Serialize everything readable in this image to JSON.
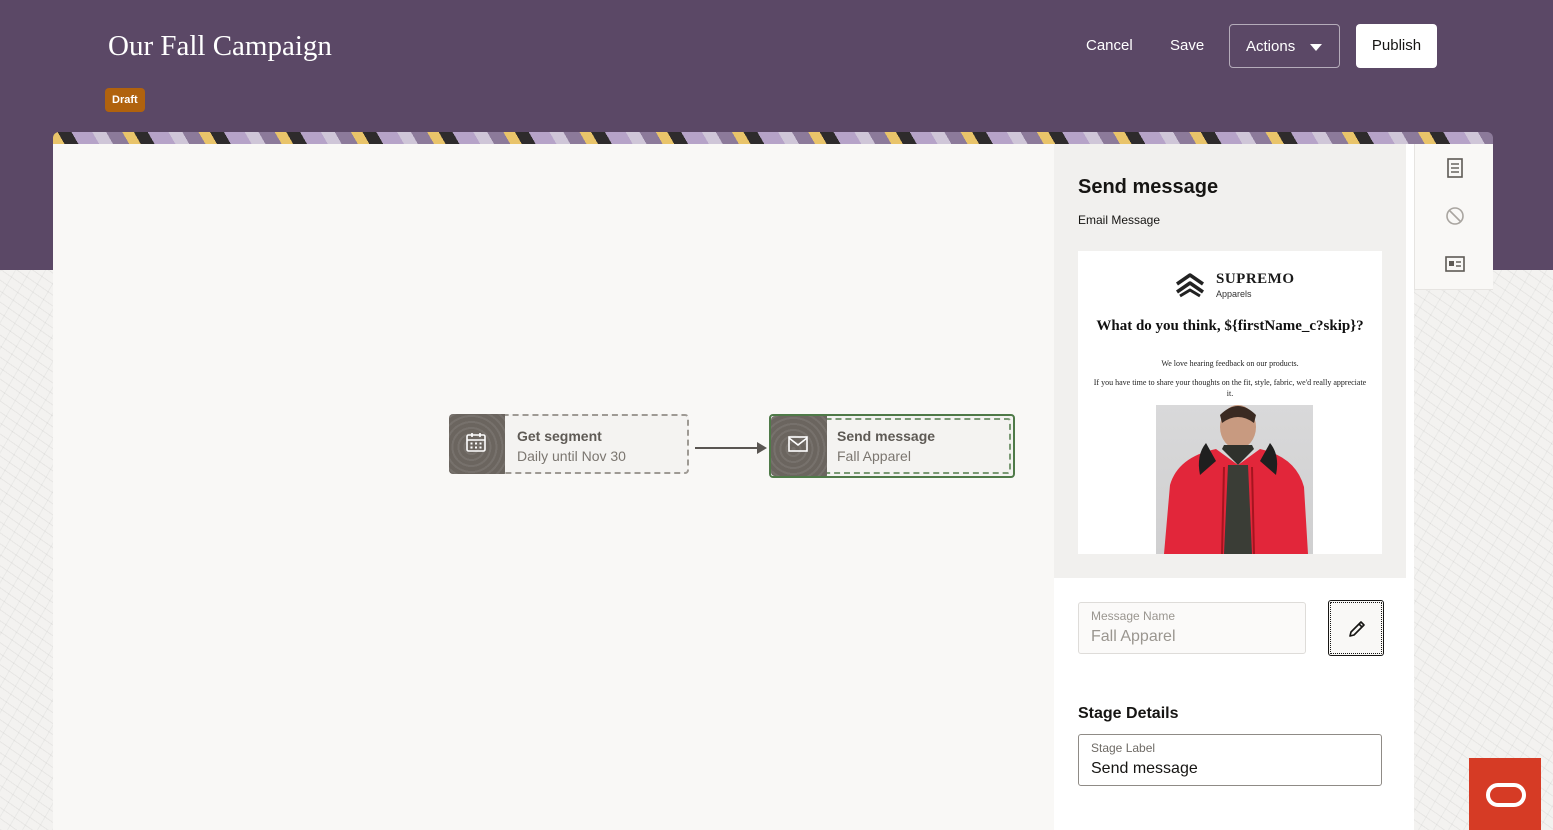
{
  "header": {
    "title": "Our Fall Campaign",
    "status_badge": "Draft",
    "cancel_label": "Cancel",
    "save_label": "Save",
    "actions_label": "Actions",
    "publish_label": "Publish"
  },
  "flow": {
    "nodes": [
      {
        "title": "Get segment",
        "subtitle": "Daily until Nov 30",
        "icon": "calendar-icon"
      },
      {
        "title": "Send message",
        "subtitle": "Fall Apparel",
        "icon": "envelope-icon"
      }
    ]
  },
  "panel": {
    "title": "Send message",
    "subtitle": "Email Message",
    "preview": {
      "brand_name": "SUPREMO",
      "brand_sub": "Apparels",
      "headline": "What do you think, ${firstName_c?skip}?",
      "paragraph1": "We love hearing feedback on our products.",
      "paragraph2": "If you have time to share your thoughts on the fit, style, fabric, we'd really appreciate it."
    },
    "message_name": {
      "label": "Message Name",
      "value": "Fall Apparel"
    },
    "stage_details_title": "Stage Details",
    "stage_label": {
      "label": "Stage Label",
      "value": "Send message"
    }
  },
  "colors": {
    "header_bg": "#5b4866",
    "draft_badge": "#b0620e",
    "selected_node_border": "#4f7a48",
    "chat_button": "#d63b25"
  }
}
